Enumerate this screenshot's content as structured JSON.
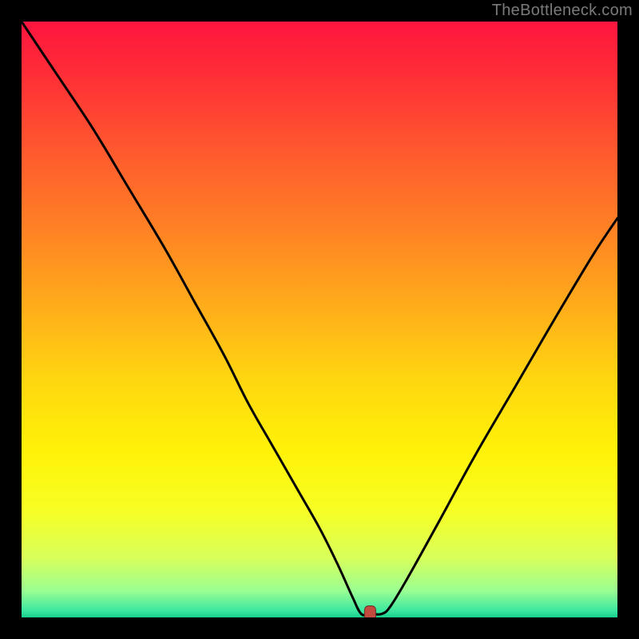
{
  "watermark": "TheBottleneck.com",
  "colors": {
    "frame": "#000000",
    "text": "#7a7a7a",
    "curve": "#000000",
    "marker_fill": "#c24a3f",
    "marker_stroke": "#6b2f27",
    "gradient_stops": [
      {
        "offset": 0.0,
        "color": "#ff153f"
      },
      {
        "offset": 0.1,
        "color": "#ff3136"
      },
      {
        "offset": 0.22,
        "color": "#ff5a2e"
      },
      {
        "offset": 0.35,
        "color": "#ff8224"
      },
      {
        "offset": 0.48,
        "color": "#ffad1a"
      },
      {
        "offset": 0.6,
        "color": "#ffd610"
      },
      {
        "offset": 0.72,
        "color": "#fff207"
      },
      {
        "offset": 0.82,
        "color": "#f7ff24"
      },
      {
        "offset": 0.9,
        "color": "#d8ff5a"
      },
      {
        "offset": 0.955,
        "color": "#9bff92"
      },
      {
        "offset": 0.99,
        "color": "#38e6a0"
      },
      {
        "offset": 1.0,
        "color": "#17cf8b"
      }
    ]
  },
  "chart_data": {
    "type": "line",
    "title": "",
    "xlabel": "",
    "ylabel": "",
    "xlim": [
      0,
      100
    ],
    "ylim": [
      0,
      100
    ],
    "grid": false,
    "legend": null,
    "series": [
      {
        "name": "bottleneck-curve",
        "x": [
          0,
          6,
          12,
          18,
          24,
          29,
          34,
          38,
          42,
          46,
          50,
          53,
          55.5,
          57,
          58.5,
          60.5,
          62,
          65,
          70,
          76,
          83,
          90,
          96,
          100
        ],
        "y": [
          100,
          91,
          82,
          72,
          62,
          53,
          44,
          36,
          29,
          22,
          15,
          9,
          3.5,
          0.6,
          0.6,
          0.6,
          2,
          7,
          16,
          27,
          39,
          51,
          61,
          67
        ]
      }
    ],
    "marker": {
      "x": 58.5,
      "y": 0.6,
      "shape": "rounded-rect"
    }
  }
}
